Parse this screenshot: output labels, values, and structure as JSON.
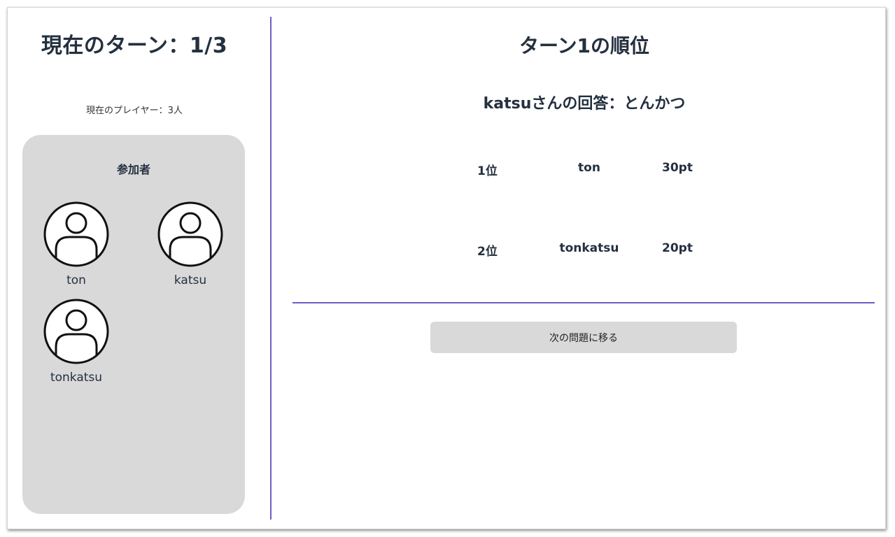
{
  "sidebar": {
    "turn_title": "現在のターン：1/3",
    "player_count": "現在のプレイヤー：3人",
    "participants_title": "参加者",
    "participants": [
      {
        "name": "ton",
        "icon": "user-avatar-icon"
      },
      {
        "name": "katsu",
        "icon": "user-avatar-icon"
      },
      {
        "name": "tonkatsu",
        "icon": "user-avatar-icon"
      }
    ]
  },
  "main": {
    "round_title": "ターン1の順位",
    "answer": "katsuさんの回答：とんかつ",
    "rankings": [
      {
        "rank": "1位",
        "player": "ton",
        "points": "30pt"
      },
      {
        "rank": "2位",
        "player": "tonkatsu",
        "points": "20pt"
      }
    ],
    "next_button_label": "次の問題に移る"
  },
  "colors": {
    "accent_line": "#6b5fc7",
    "panel_bg": "#d9d9d9",
    "heading_text": "#24303f"
  }
}
